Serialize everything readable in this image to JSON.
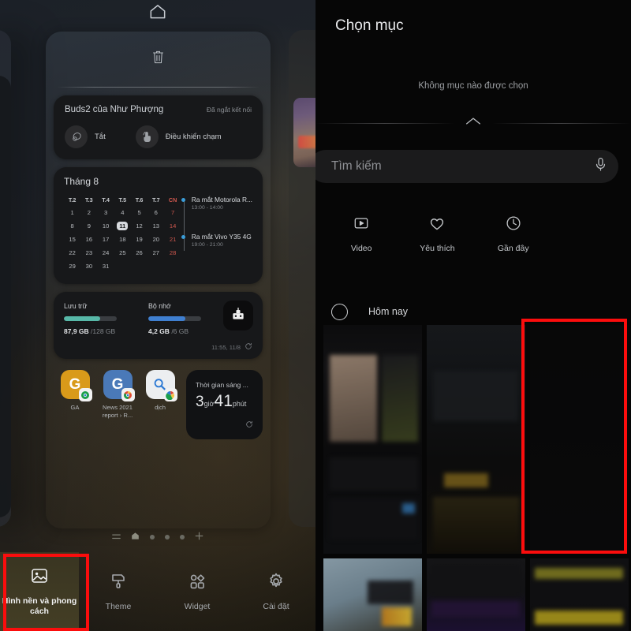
{
  "left_panel": {
    "home_icon": "home-icon",
    "trash_icon": "trash-icon",
    "buds_widget": {
      "title": "Buds2 của Như Phượng",
      "status": "Đã ngắt kết nối",
      "actions": [
        {
          "label": "Tắt",
          "icon": "earbud-icon"
        },
        {
          "label": "Điều khiển chạm",
          "icon": "touch-control-icon"
        }
      ]
    },
    "calendar_widget": {
      "title": "Tháng 8",
      "day_headers": [
        "T.2",
        "T.3",
        "T.4",
        "T.5",
        "T.6",
        "T.7",
        "CN"
      ],
      "weeks": [
        [
          "1",
          "2",
          "3",
          "4",
          "5",
          "6",
          "7"
        ],
        [
          "8",
          "9",
          "10",
          "11",
          "12",
          "13",
          "14"
        ],
        [
          "15",
          "16",
          "17",
          "18",
          "19",
          "20",
          "21"
        ],
        [
          "22",
          "23",
          "24",
          "25",
          "26",
          "27",
          "28"
        ],
        [
          "29",
          "30",
          "31",
          "",
          "",
          "",
          ""
        ]
      ],
      "today": "11",
      "events": [
        {
          "name": "Ra mắt Motorola R...",
          "time": "13:00 - 14:00"
        },
        {
          "name": "Ra mắt Vivo Y35 4G",
          "time": "19:00 - 21:00"
        }
      ]
    },
    "storage_widget": {
      "storage": {
        "label": "Lưu trữ",
        "used": "87,9 GB",
        "total": "/128 GB",
        "percent": 69,
        "color": "#57b8a8"
      },
      "memory": {
        "label": "Bộ nhớ",
        "used": "4,2 GB",
        "total": "/6 GB",
        "percent": 70,
        "color": "#3f7fd0"
      },
      "updated": "11:55, 11/8",
      "refresh_icon": "refresh-icon",
      "clean_icon": "memory-clean-icon"
    },
    "apps": [
      {
        "name": "GA",
        "letter": "G",
        "color": "#d99a1a",
        "badge": "chrome-icon"
      },
      {
        "name": "News 2021 report › R...",
        "letter": "G",
        "color": "#4a79b8",
        "badge": "chrome-icon"
      },
      {
        "name": "dịch",
        "letter": "",
        "color": "#eceef0",
        "badge": "google-icon"
      }
    ],
    "screen_time_widget": {
      "title": "Thời gian sáng ...",
      "hours": "3",
      "hours_unit": "giờ",
      "minutes": "41",
      "minutes_unit": "phút",
      "refresh_icon": "refresh-icon"
    },
    "pager": {
      "icons": [
        "list-icon",
        "home-icon"
      ],
      "dots": 3,
      "add_icon": "plus-icon"
    },
    "bottom_nav": [
      {
        "label": "Hình nền và phong cách",
        "icon": "wallpaper-icon",
        "active": true
      },
      {
        "label": "Theme",
        "icon": "theme-brush-icon",
        "active": false
      },
      {
        "label": "Widget",
        "icon": "widget-grid-icon",
        "active": false
      },
      {
        "label": "Cài đặt",
        "icon": "gear-icon",
        "active": false
      }
    ]
  },
  "right_panel": {
    "title": "Chọn mục",
    "empty_text": "Không mục nào được chọn",
    "chevron_icon": "chevron-up-icon",
    "search": {
      "placeholder": "Tìm kiếm",
      "mic_icon": "microphone-icon"
    },
    "categories": [
      {
        "label": "Video",
        "icon": "video-icon"
      },
      {
        "label": "Yêu thích",
        "icon": "heart-icon"
      },
      {
        "label": "Gần đây",
        "icon": "clock-icon"
      }
    ],
    "today_group": {
      "label": "Hôm nay",
      "checkbox_icon": "circle-checkbox-icon"
    },
    "selected_thumb": {
      "checkbox_icon": "circle-checkbox-icon",
      "expand_icon": "expand-icon"
    }
  },
  "highlights": {
    "color": "#fb0d0d",
    "boxes": [
      "bottom-nav-wallpaper",
      "selected-flower-thumbnail"
    ]
  }
}
